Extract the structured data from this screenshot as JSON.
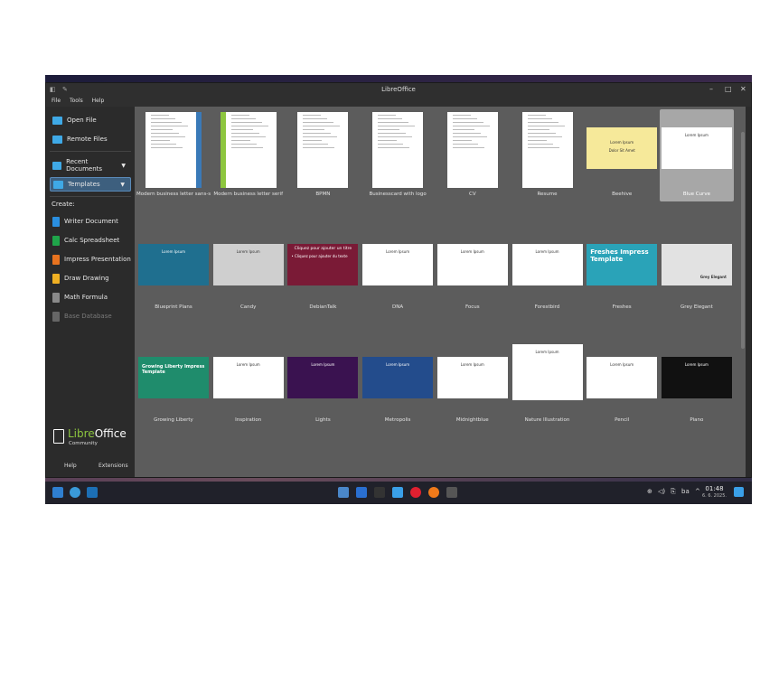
{
  "window": {
    "title": "LibreOffice",
    "controls": [
      "–",
      "□",
      "✕"
    ]
  },
  "menu": [
    "File",
    "Tools",
    "Help"
  ],
  "sidebar": {
    "open_file": "Open File",
    "remote_files": "Remote Files",
    "recent_documents": "Recent Documents",
    "templates": "Templates",
    "create_label": "Create:",
    "create_items": [
      {
        "label": "Writer Document",
        "color": "#2a8fe0"
      },
      {
        "label": "Calc Spreadsheet",
        "color": "#1fa54a"
      },
      {
        "label": "Impress Presentation",
        "color": "#e8731f"
      },
      {
        "label": "Draw Drawing",
        "color": "#f0b023"
      },
      {
        "label": "Math Formula",
        "color": "#8a8a8a"
      },
      {
        "label": "Base Database",
        "color": "#777777"
      }
    ],
    "logo_libre": "Libre",
    "logo_office": "Office",
    "logo_community": "Community",
    "help": "Help",
    "extensions": "Extensions"
  },
  "templates": [
    {
      "label": "Modern business letter sans-serif",
      "kind": "doc"
    },
    {
      "label": "Modern business letter serif",
      "kind": "doc"
    },
    {
      "label": "BPMN",
      "kind": "doc"
    },
    {
      "label": "Businesscard with logo",
      "kind": "doc"
    },
    {
      "label": "CV",
      "kind": "doc"
    },
    {
      "label": "Resume",
      "kind": "doc"
    },
    {
      "label": "Beehive",
      "kind": "slide",
      "bg": "#f6e99a"
    },
    {
      "label": "Blue Curve",
      "kind": "slide",
      "bg": "#ffffff",
      "selected": true
    },
    {
      "label": "Blueprint Plans",
      "kind": "slide",
      "bg": "#1f6f8f"
    },
    {
      "label": "Candy",
      "kind": "slide",
      "bg": "#cfcfcf"
    },
    {
      "label": "DebianTalk",
      "kind": "slide",
      "bg": "#7a1a36"
    },
    {
      "label": "DNA",
      "kind": "slide",
      "bg": "#ffffff"
    },
    {
      "label": "Focus",
      "kind": "slide",
      "bg": "#ffffff"
    },
    {
      "label": "Forestbird",
      "kind": "slide",
      "bg": "#ffffff"
    },
    {
      "label": "Freshes",
      "kind": "slide",
      "bg": "#2aa3b8"
    },
    {
      "label": "Grey Elegant",
      "kind": "slide",
      "bg": "#e2e2e2"
    },
    {
      "label": "Growing Liberty",
      "kind": "slide",
      "bg": "#1f8c6c"
    },
    {
      "label": "Inspiration",
      "kind": "slide",
      "bg": "#ffffff"
    },
    {
      "label": "Lights",
      "kind": "slide",
      "bg": "#3a1250"
    },
    {
      "label": "Metropolis",
      "kind": "slide",
      "bg": "#234c8c"
    },
    {
      "label": "Midnightblue",
      "kind": "slide",
      "bg": "#ffffff"
    },
    {
      "label": "Nature Illustration",
      "kind": "slide",
      "bg": "#ffffff"
    },
    {
      "label": "Pencil",
      "kind": "slide",
      "bg": "#ffffff"
    },
    {
      "label": "Piano",
      "kind": "slide",
      "bg": "#111111"
    }
  ],
  "thumb_text": {
    "lorem": "Lorem Ipsum",
    "dolor": "Dolor Sit Amet",
    "debian": "Cliquez pour ajouter un titre",
    "debian_sub": "• Cliquez pour ajouter du texte",
    "freshes": "Freshes Impress Template",
    "growing": "Growing Liberty Impress Template",
    "grey": "Grey Elegant"
  },
  "taskbar": {
    "tray_lang": "ba",
    "time": "01:48",
    "date": "6. 6. 2025."
  }
}
